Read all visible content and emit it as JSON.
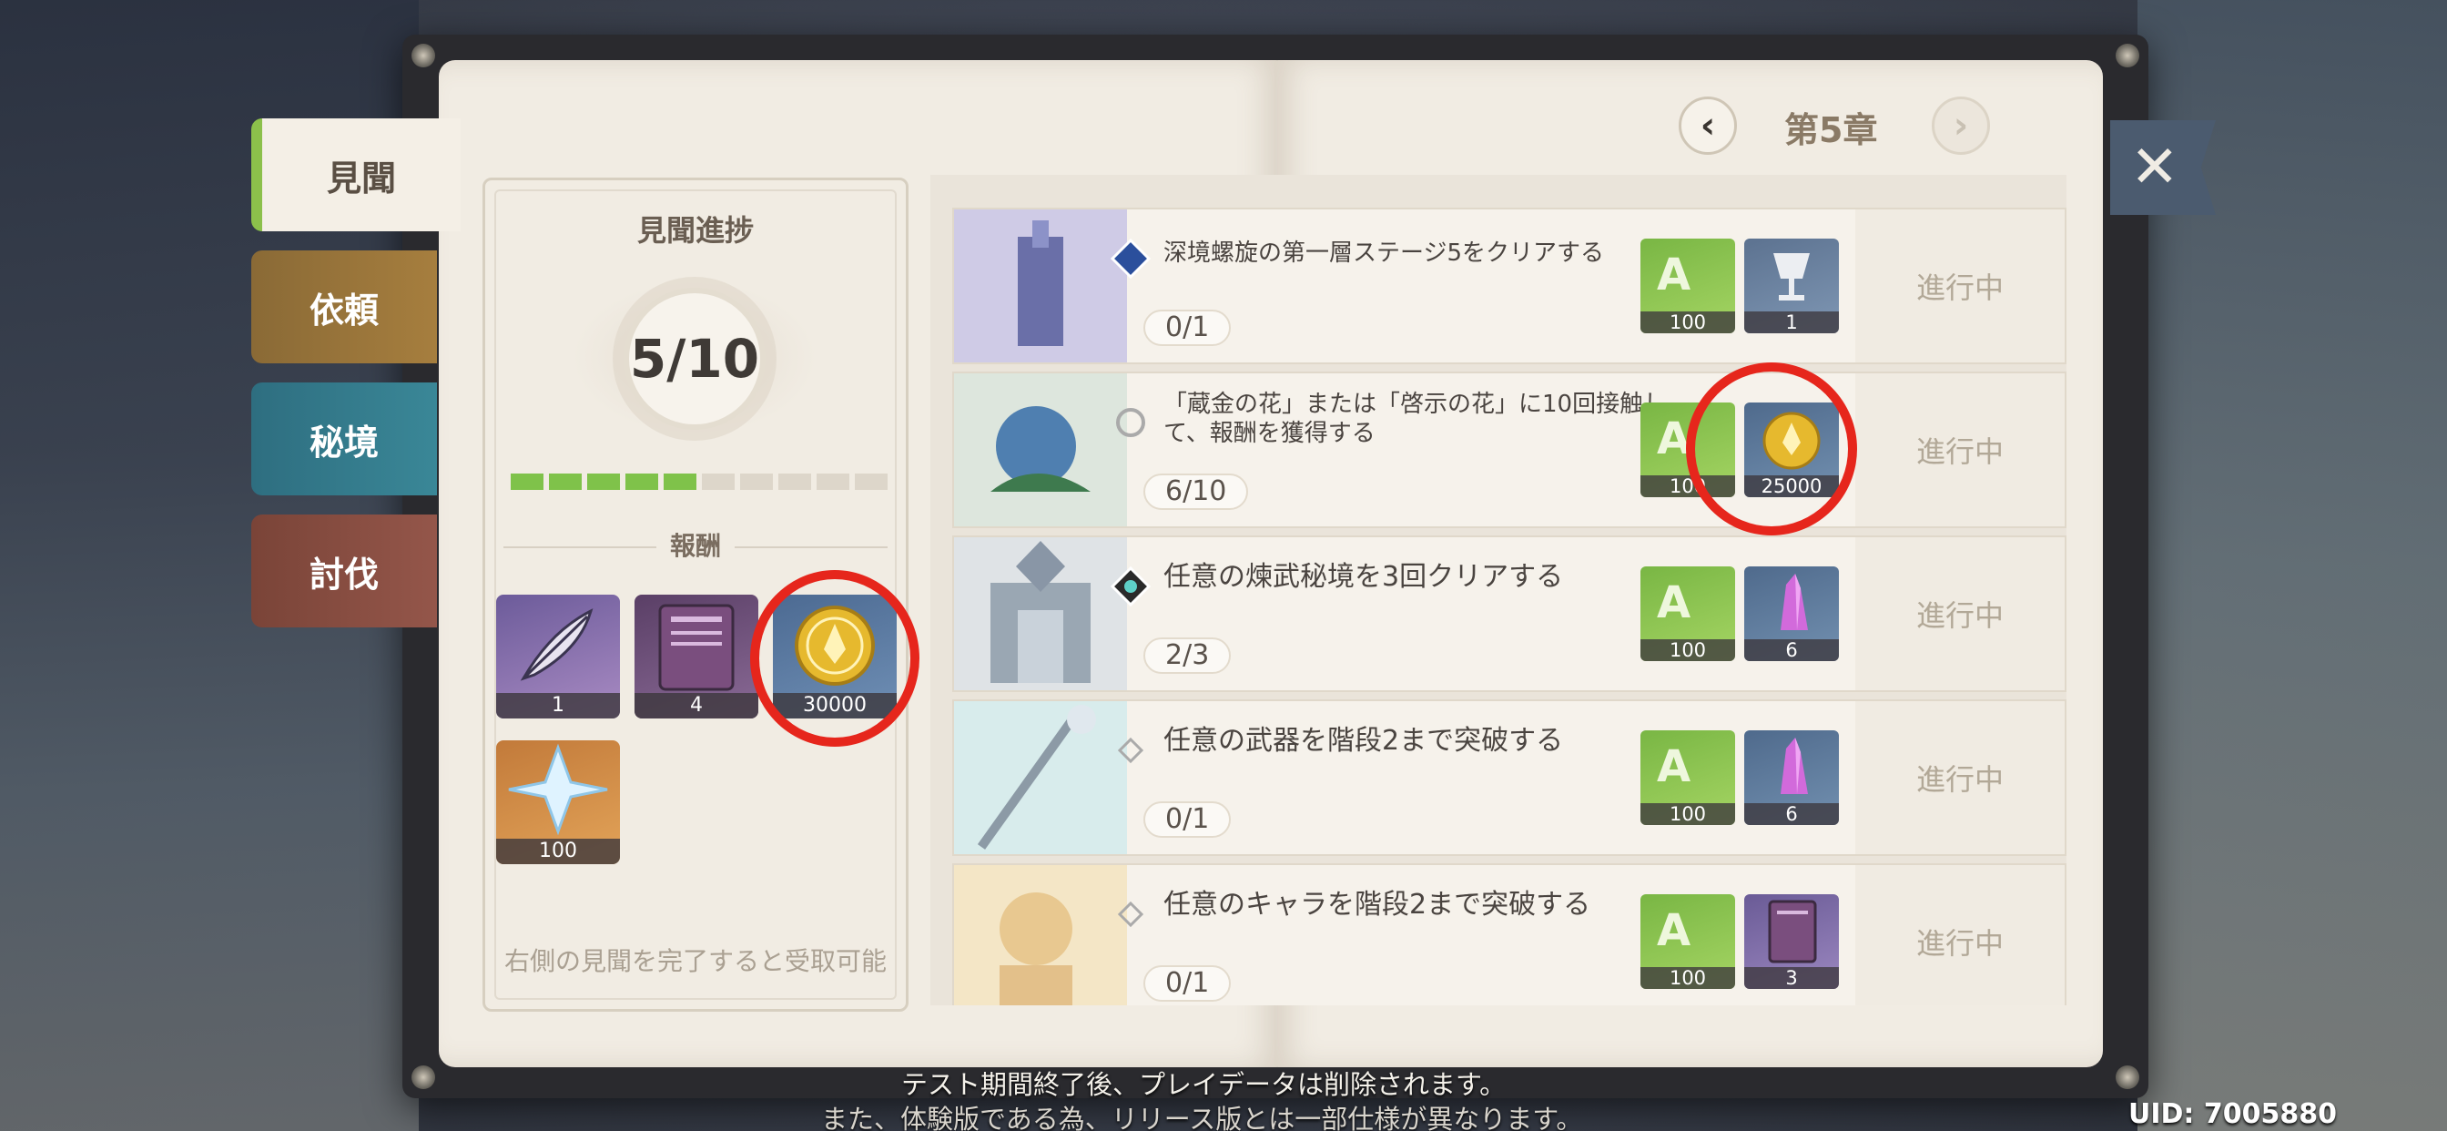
{
  "tabs": [
    {
      "label": "見聞",
      "active": true
    },
    {
      "label": "依頼"
    },
    {
      "label": "秘境"
    },
    {
      "label": "討伐"
    }
  ],
  "progress": {
    "title": "見聞進捗",
    "value": "5/10",
    "completed_segments": 5,
    "total_segments": 10,
    "reward_label": "報酬",
    "rewards": [
      {
        "icon": "feather-icon",
        "count": "1"
      },
      {
        "icon": "book-icon",
        "count": "4"
      },
      {
        "icon": "mora-coin-icon",
        "count": "30000"
      },
      {
        "icon": "primogem-icon",
        "count": "100"
      }
    ],
    "footer": "右側の見聞を完了すると受取可能"
  },
  "chapter": {
    "title": "第5章",
    "prev_icon": "‹",
    "next_icon": "›"
  },
  "close_icon": "✕",
  "tasks": [
    {
      "title": "深境螺旋の第一層ステージ5をクリアする",
      "progress": "0/1",
      "rewards": [
        {
          "icon": "adventure-exp-icon",
          "count": "100"
        },
        {
          "icon": "goblet-icon",
          "count": "1"
        }
      ],
      "status": "進行中"
    },
    {
      "title": "「蔵金の花」または「啓示の花」に10回接触して、報酬を獲得する",
      "progress": "6/10",
      "rewards": [
        {
          "icon": "adventure-exp-icon",
          "count": "100"
        },
        {
          "icon": "mora-coin-icon",
          "count": "25000"
        }
      ],
      "status": "進行中"
    },
    {
      "title": "任意の煉武秘境を3回クリアする",
      "progress": "2/3",
      "rewards": [
        {
          "icon": "adventure-exp-icon",
          "count": "100"
        },
        {
          "icon": "crystal-icon",
          "count": "6"
        }
      ],
      "status": "進行中"
    },
    {
      "title": "任意の武器を階段2まで突破する",
      "progress": "0/1",
      "rewards": [
        {
          "icon": "adventure-exp-icon",
          "count": "100"
        },
        {
          "icon": "crystal-icon",
          "count": "6"
        }
      ],
      "status": "進行中"
    },
    {
      "title": "任意のキャラを階段2まで突破する",
      "progress": "0/1",
      "rewards": [
        {
          "icon": "adventure-exp-icon",
          "count": "100"
        },
        {
          "icon": "book-icon",
          "count": "3"
        }
      ],
      "status": "進行中"
    }
  ],
  "notice_line1": "テスト期間終了後、プレイデータは削除されます。",
  "notice_line2": "また、体験版である為、リリース版とは一部仕様が異なります。",
  "uid": "UID: 7005880",
  "colors": {
    "highlight_ring": "#e6261c",
    "progress_on": "#7fc24a",
    "tab_active_accent": "#8cc04b"
  }
}
